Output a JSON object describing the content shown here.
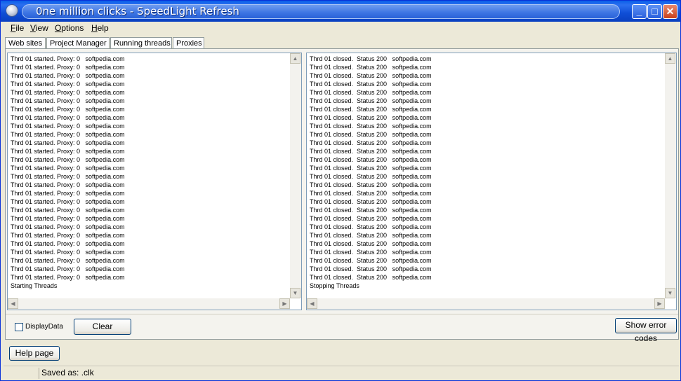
{
  "window": {
    "title": "0ne million clicks - SpeedLight Refresh"
  },
  "menu": [
    {
      "u": "F",
      "rest": "ile"
    },
    {
      "u": "V",
      "rest": "iew"
    },
    {
      "u": "O",
      "rest": "ptions"
    },
    {
      "u": "H",
      "rest": "elp"
    }
  ],
  "tabs": [
    "Web sites",
    "Project Manager",
    "Running threads",
    "Proxies"
  ],
  "left_log": {
    "line": "Thrd 01 started. Proxy: 0   softpedia.com",
    "repeat": 27,
    "last": "Starting Threads"
  },
  "right_log": {
    "line": "Thrd 01 closed.  Status 200   softpedia.com",
    "repeat": 27,
    "last": "Stopping Threads"
  },
  "controls": {
    "display_data_label": "DisplayData",
    "display_data_checked": false,
    "clear_label": "Clear",
    "show_error_codes_label": "Show error codes",
    "help_page_label": "Help page"
  },
  "status": {
    "text": "Saved as: .clk"
  }
}
